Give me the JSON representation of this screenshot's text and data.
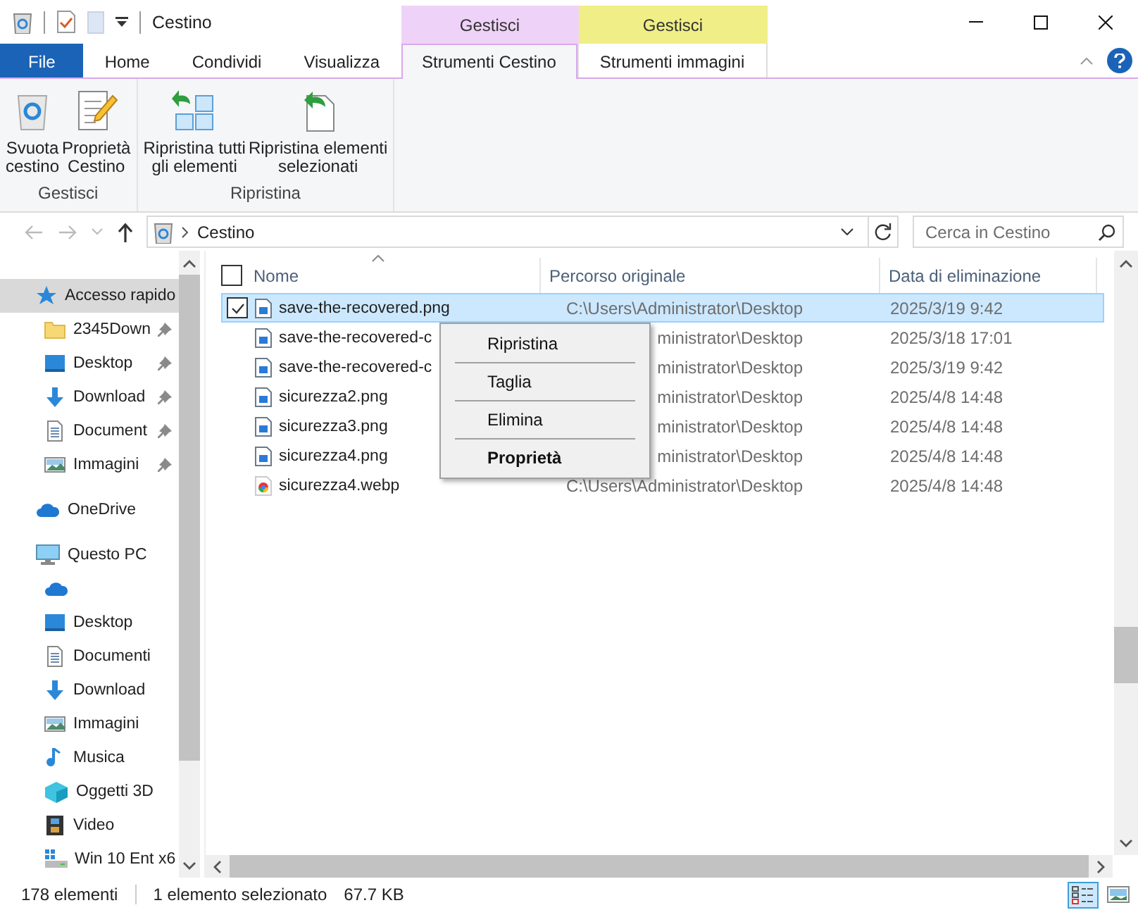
{
  "window": {
    "title": "Cestino"
  },
  "ribbon_tabs": [
    {
      "label": "File",
      "kind": "file",
      "selected": false
    },
    {
      "label": "Home",
      "kind": "tab",
      "selected": false
    },
    {
      "label": "Condividi",
      "kind": "tab",
      "selected": false
    },
    {
      "label": "Visualizza",
      "kind": "tab",
      "selected": false
    }
  ],
  "context_groups": [
    {
      "label": "Gestisci",
      "color": "#efd2f8",
      "tabs": [
        {
          "label": "Strumenti Cestino",
          "selected": true
        }
      ]
    },
    {
      "label": "Gestisci",
      "color": "#f0ee86",
      "tabs": [
        {
          "label": "Strumenti immagini",
          "selected": false
        }
      ]
    }
  ],
  "ribbon_groups": [
    {
      "label": "Gestisci",
      "buttons": [
        {
          "label": "Svuota\ncestino",
          "kind": "empty-bin"
        },
        {
          "label": "Proprietà\nCestino",
          "kind": "properties"
        }
      ]
    },
    {
      "label": "Ripristina",
      "buttons": [
        {
          "label": "Ripristina tutti\ngli elementi",
          "kind": "restore-all"
        },
        {
          "label": "Ripristina elementi\nselezionati",
          "kind": "restore-selected"
        }
      ]
    }
  ],
  "address": {
    "path": "Cestino"
  },
  "search": {
    "placeholder": "Cerca in Cestino"
  },
  "sidebar": {
    "items": [
      {
        "label": "Accesso rapido",
        "kind": "star",
        "selected": true,
        "children": [
          {
            "label": "2345Down",
            "kind": "folder",
            "pinned": true,
            "selected": false
          },
          {
            "label": "Desktop",
            "kind": "desktop",
            "pinned": true,
            "selected": false
          },
          {
            "label": "Download",
            "kind": "download",
            "pinned": true,
            "selected": false
          },
          {
            "label": "Document",
            "kind": "document",
            "pinned": true,
            "selected": false
          },
          {
            "label": "Immagini",
            "kind": "pictures",
            "pinned": true,
            "selected": false
          }
        ]
      },
      {
        "label": "OneDrive",
        "kind": "cloud",
        "selected": false
      },
      {
        "label": "Questo PC",
        "kind": "pc",
        "selected": false,
        "children": [
          {
            "kind": "cloud",
            "selected": false
          },
          {
            "label": "Desktop",
            "kind": "desktop",
            "selected": false
          },
          {
            "label": "Documenti",
            "kind": "document",
            "selected": false
          },
          {
            "label": "Download",
            "kind": "download",
            "selected": false
          },
          {
            "label": "Immagini",
            "kind": "pictures",
            "selected": false
          },
          {
            "label": "Musica",
            "kind": "music",
            "selected": false
          },
          {
            "label": "Oggetti 3D",
            "kind": "cube",
            "selected": false
          },
          {
            "label": "Video",
            "kind": "video",
            "selected": false
          },
          {
            "label": "Win 10 Ent x6",
            "kind": "drive",
            "selected": false
          }
        ]
      }
    ]
  },
  "select_all": {
    "checked": false
  },
  "columns": [
    "Nome",
    "Percorso originale",
    "Data di eliminazione"
  ],
  "files": [
    {
      "name": "save-the-recovered.png",
      "path": "C:\\Users\\Administrator\\Desktop",
      "date": "2025/3/19 9:42",
      "kind": "image",
      "selected": true
    },
    {
      "name": "save-the-recovered-c",
      "path": "ministrator\\Desktop",
      "date": "2025/3/18 17:01",
      "kind": "image",
      "selected": false
    },
    {
      "name": "save-the-recovered-c",
      "path": "ministrator\\Desktop",
      "date": "2025/3/19 9:42",
      "kind": "image",
      "selected": false
    },
    {
      "name": "sicurezza2.png",
      "path": "ministrator\\Desktop",
      "date": "2025/4/8 14:48",
      "kind": "image",
      "selected": false
    },
    {
      "name": "sicurezza3.png",
      "path": "ministrator\\Desktop",
      "date": "2025/4/8 14:48",
      "kind": "image",
      "selected": false
    },
    {
      "name": "sicurezza4.png",
      "path": "ministrator\\Desktop",
      "date": "2025/4/8 14:48",
      "kind": "image",
      "selected": false
    },
    {
      "name": "sicurezza4.webp",
      "path": "C:\\Users\\Administrator\\Desktop",
      "date": "2025/4/8 14:48",
      "kind": "web",
      "selected": false
    }
  ],
  "context_menu": {
    "items": [
      {
        "label": "Ripristina",
        "default": false
      },
      {
        "label": "Taglia",
        "default": false
      },
      {
        "label": "Elimina",
        "default": false
      },
      {
        "label": "Proprietà",
        "default": true
      }
    ]
  },
  "status_bar": {
    "count": "178 elementi",
    "selection": "1 elemento selezionato",
    "size": "67.7 KB"
  },
  "view_buttons": [
    {
      "kind": "details",
      "selected": true
    },
    {
      "kind": "thumbnails",
      "selected": false
    }
  ]
}
